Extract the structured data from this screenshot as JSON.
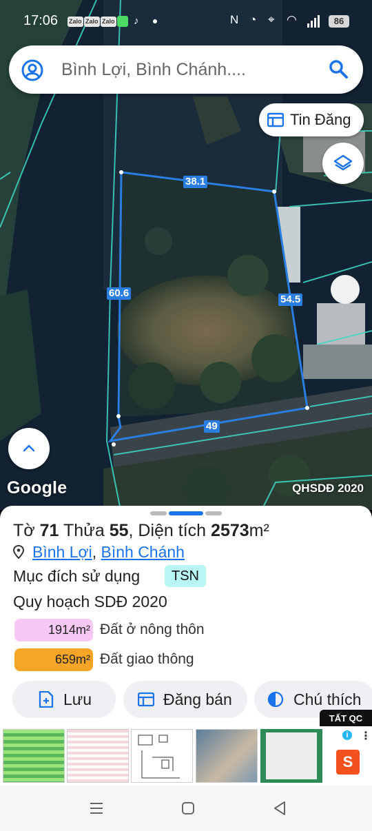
{
  "status": {
    "time": "17:06",
    "apps": [
      "Zalo",
      "Zalo",
      "Zalo"
    ],
    "battery": "86"
  },
  "search": {
    "placeholder": "Bình Lợi, Bình Chánh...."
  },
  "map": {
    "tin_dang_label": "Tin Đăng",
    "google_logo": "Google",
    "layer_name": "QHSDĐ 2020",
    "dimensions": {
      "top": "38.1",
      "left": "60.6",
      "right": "54.5",
      "bottom": "49"
    }
  },
  "parcel": {
    "to_label": "Tờ",
    "to_value": "71",
    "thua_label": "Thửa",
    "thua_value": "55",
    "dientich_label": ", Diện tích",
    "dientich_value": "2573",
    "unit": "m²",
    "ward": "Bình Lợi",
    "district": "Bình Chánh",
    "purpose_label": "Mục đích sử dụng",
    "purpose_code": "TSN",
    "plan_title": "Quy hoạch SDĐ 2020",
    "zones": [
      {
        "area": "1914m²",
        "name": "Đất ở nông thôn",
        "color": "#f8c8f4"
      },
      {
        "area": "659m²",
        "name": "Đất giao thông",
        "color": "#f7a526"
      }
    ]
  },
  "actions": {
    "save": "Lưu",
    "post": "Đăng bán",
    "legend": "Chú thích"
  },
  "ads": {
    "label": "TẤT QC",
    "info": "i",
    "brand": "S"
  },
  "colors": {
    "accent": "#1a73e8",
    "parcel_outline": "#2a7de1",
    "cadastral_lines": "#3fd9c8"
  }
}
